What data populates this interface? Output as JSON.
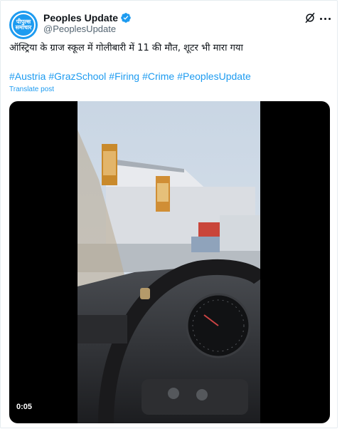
{
  "author": {
    "display_name": "Peoples Update",
    "handle": "@PeoplesUpdate",
    "avatar_text": "पीपुल्स समाचार",
    "avatar_icon": "peoples-samachar-logo",
    "verified_icon": "verified-badge-icon"
  },
  "header_icons": {
    "grok": "grok-icon",
    "more": "more-dots-icon"
  },
  "post": {
    "text": "ऑस्ट्रिया के ग्राज स्कूल में गोलीबारी में 11 की मौत, शूटर भी मारा गया",
    "hashtags": [
      "#Austria",
      "#GrazSchool",
      "#Firing",
      "#Crime",
      "#PeoplesUpdate"
    ],
    "translate_label": "Translate post"
  },
  "video": {
    "duration": "0:05",
    "description_icon": "video-thumbnail"
  },
  "colors": {
    "accent": "#1d9bf0",
    "text": "#0f1419",
    "muted": "#536471"
  }
}
